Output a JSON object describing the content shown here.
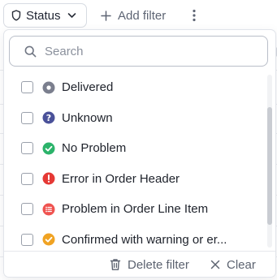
{
  "toolbar": {
    "status_label": "Status",
    "add_filter_label": "Add filter"
  },
  "dropdown": {
    "search_placeholder": "Search",
    "options": [
      {
        "label": "Delivered",
        "icon": "dot-circle-icon",
        "color": "#7b7f8e"
      },
      {
        "label": "Unknown",
        "icon": "question-circle-icon",
        "color": "#4a5199"
      },
      {
        "label": "No Problem",
        "icon": "check-circle-icon",
        "color": "#2bb36a"
      },
      {
        "label": "Error in Order Header",
        "icon": "exclamation-circle-icon",
        "color": "#e53935"
      },
      {
        "label": "Problem in Order Line Item",
        "icon": "list-circle-icon",
        "color": "#ef5350"
      },
      {
        "label": "Confirmed with warning or er...",
        "icon": "check-circle-icon",
        "color": "#f0a323"
      }
    ],
    "footer": {
      "delete_label": "Delete filter",
      "clear_label": "Clear"
    }
  }
}
